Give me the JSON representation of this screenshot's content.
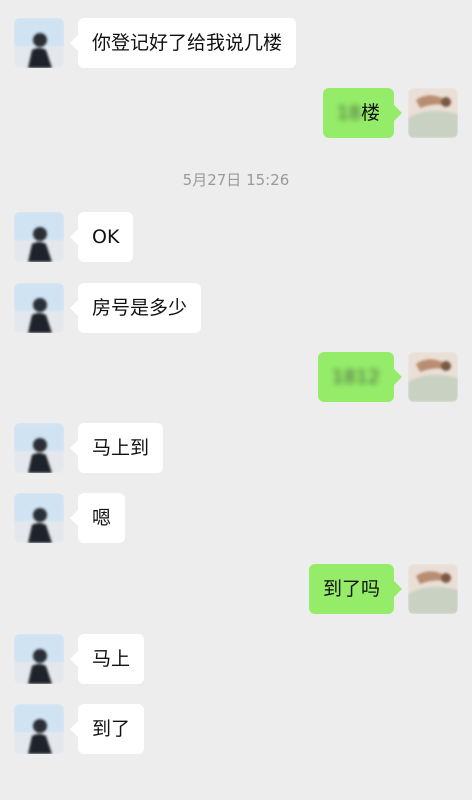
{
  "timestamp": "5月27日 15:26",
  "messages": [
    {
      "side": "left",
      "text": "你登记好了给我说几楼"
    },
    {
      "side": "right",
      "text": "楼",
      "redacted_prefix": "18"
    },
    {
      "side": "left",
      "text": "OK"
    },
    {
      "side": "left",
      "text": "房号是多少"
    },
    {
      "side": "right",
      "text": "",
      "redacted_prefix": "1812"
    },
    {
      "side": "left",
      "text": "马上到"
    },
    {
      "side": "left",
      "text": "嗯"
    },
    {
      "side": "right",
      "text": "到了吗"
    },
    {
      "side": "left",
      "text": "马上"
    },
    {
      "side": "left",
      "text": "到了"
    }
  ],
  "icons": {
    "contact_avatar": "contact-avatar",
    "own_avatar": "self-avatar"
  }
}
